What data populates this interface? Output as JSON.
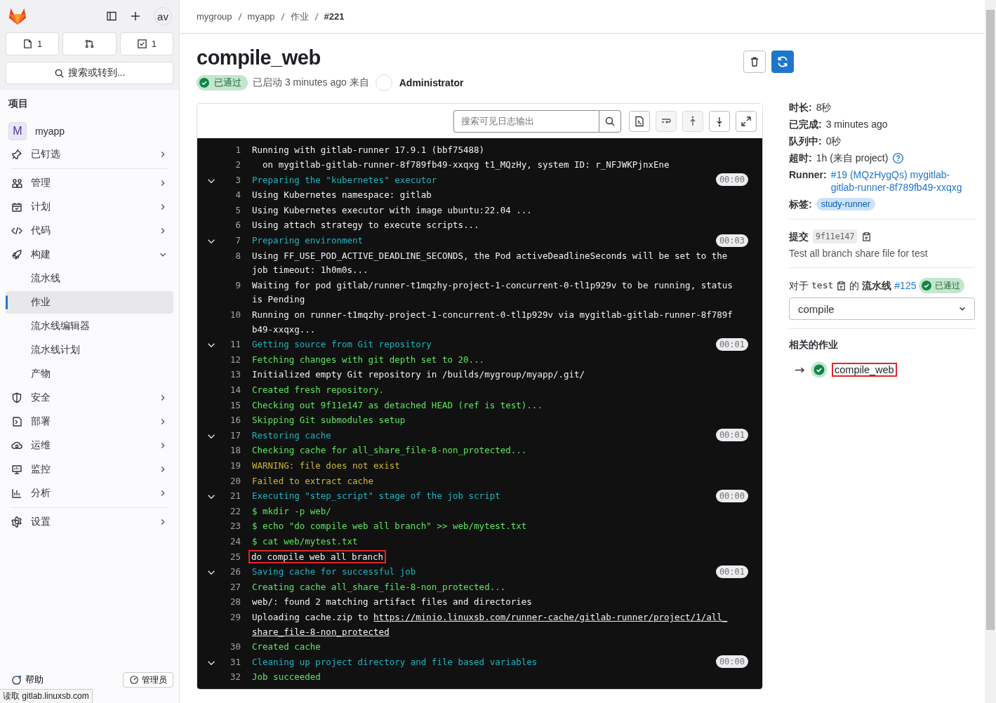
{
  "sidebar": {
    "avatar": "av",
    "top_buttons": [
      {
        "kind": "issues",
        "count": "1"
      },
      {
        "kind": "merge"
      },
      {
        "kind": "todo",
        "count": "1"
      }
    ],
    "search": "搜索或转到...",
    "section_title": "项目",
    "project": {
      "initial": "M",
      "name": "myapp"
    },
    "items": [
      {
        "label": "已钉选",
        "expanded": false
      },
      {
        "label": "管理",
        "expanded": false
      },
      {
        "label": "计划",
        "expanded": false
      },
      {
        "label": "代码",
        "expanded": false
      },
      {
        "label": "构建",
        "expanded": true,
        "children": [
          {
            "label": "流水线",
            "selected": false
          },
          {
            "label": "作业",
            "selected": true
          },
          {
            "label": "流水线编辑器",
            "selected": false
          },
          {
            "label": "流水线计划",
            "selected": false
          },
          {
            "label": "产物",
            "selected": false
          }
        ]
      },
      {
        "label": "安全",
        "expanded": false
      },
      {
        "label": "部署",
        "expanded": false
      },
      {
        "label": "运维",
        "expanded": false
      },
      {
        "label": "监控",
        "expanded": false
      },
      {
        "label": "分析",
        "expanded": false
      },
      {
        "label": "设置",
        "expanded": false
      }
    ],
    "help": "帮助",
    "admin": "管理员"
  },
  "breadcrumbs": [
    "mygroup",
    "myapp",
    "作业",
    "#221"
  ],
  "job": {
    "title": "compile_web",
    "status": "已通过",
    "meta": "已启动 3 minutes ago 来自",
    "user": "Administrator"
  },
  "log": {
    "search_placeholder": "搜索可见日志输出",
    "lines": [
      {
        "n": "1",
        "kind": "plain",
        "text": "Running with gitlab-runner 17.9.1 (bbf75488)"
      },
      {
        "n": "2",
        "kind": "plain",
        "text": "  on mygitlab-gitlab-runner-8f789fb49-xxqxg t1_MQzHy, system ID: r_NFJWKPjnxEne"
      },
      {
        "n": "3",
        "kind": "section",
        "text": "Preparing the \"kubernetes\" executor",
        "duration": "00:00"
      },
      {
        "n": "4",
        "kind": "plain",
        "text": "Using Kubernetes namespace: gitlab"
      },
      {
        "n": "5",
        "kind": "plain",
        "text": "Using Kubernetes executor with image ubuntu:22.04 ..."
      },
      {
        "n": "6",
        "kind": "plain",
        "text": "Using attach strategy to execute scripts..."
      },
      {
        "n": "7",
        "kind": "section",
        "text": "Preparing environment",
        "duration": "00:03"
      },
      {
        "n": "8",
        "kind": "plain",
        "text": "Using FF_USE_POD_ACTIVE_DEADLINE_SECONDS, the Pod activeDeadlineSeconds will be set to the job timeout: 1h0m0s..."
      },
      {
        "n": "9",
        "kind": "plain",
        "text": "Waiting for pod gitlab/runner-t1mqzhy-project-1-concurrent-0-tl1p929v to be running, status is Pending"
      },
      {
        "n": "10",
        "kind": "plain",
        "text": "Running on runner-t1mqzhy-project-1-concurrent-0-tl1p929v via mygitlab-gitlab-runner-8f789fb49-xxqxg..."
      },
      {
        "n": "11",
        "kind": "section",
        "text": "Getting source from Git repository",
        "duration": "00:01"
      },
      {
        "n": "12",
        "kind": "success",
        "text": "Fetching changes with git depth set to 20..."
      },
      {
        "n": "13",
        "kind": "plain",
        "text": "Initialized empty Git repository in /builds/mygroup/myapp/.git/"
      },
      {
        "n": "14",
        "kind": "success",
        "text": "Created fresh repository."
      },
      {
        "n": "15",
        "kind": "success",
        "text": "Checking out 9f11e147 as detached HEAD (ref is test)..."
      },
      {
        "n": "16",
        "kind": "success",
        "text": "Skipping Git submodules setup"
      },
      {
        "n": "17",
        "kind": "section",
        "text": "Restoring cache",
        "duration": "00:01"
      },
      {
        "n": "18",
        "kind": "success",
        "text": "Checking cache for all_share_file-8-non_protected..."
      },
      {
        "n": "19",
        "kind": "warning",
        "text": "WARNING: file does not exist"
      },
      {
        "n": "20",
        "kind": "warning",
        "text": "Failed to extract cache"
      },
      {
        "n": "21",
        "kind": "section",
        "text": "Executing \"step_script\" stage of the job script",
        "duration": "00:00"
      },
      {
        "n": "22",
        "kind": "success",
        "text": "$ mkdir -p web/"
      },
      {
        "n": "23",
        "kind": "success",
        "text": "$ echo \"do compile web all branch\" >> web/mytest.txt"
      },
      {
        "n": "24",
        "kind": "success",
        "text": "$ cat web/mytest.txt"
      },
      {
        "n": "25",
        "kind": "plain",
        "text": "do compile web all branch",
        "highlighted": true
      },
      {
        "n": "26",
        "kind": "section",
        "text": "Saving cache for successful job",
        "duration": "00:01"
      },
      {
        "n": "27",
        "kind": "success",
        "text": "Creating cache all_share_file-8-non_protected..."
      },
      {
        "n": "28",
        "kind": "plain",
        "text": "web/: found 2 matching artifact files and directories"
      },
      {
        "n": "29",
        "kind": "plain",
        "text": "Uploading cache.zip to ",
        "link_lines": [
          "https://minio.linuxsb.com/runner-cache/gitlab-runner/project/1/all_",
          "share_file-8-non_protected"
        ]
      },
      {
        "n": "30",
        "kind": "success",
        "text": "Created cache"
      },
      {
        "n": "31",
        "kind": "section",
        "text": "Cleaning up project directory and file based variables",
        "duration": "00:00"
      },
      {
        "n": "32",
        "kind": "success",
        "text": "Job succeeded"
      }
    ]
  },
  "details": {
    "rows": [
      {
        "label": "时长:",
        "value": "8秒"
      },
      {
        "label": "已完成:",
        "value": "3 minutes ago"
      },
      {
        "label": "队列中:",
        "value": "0秒"
      },
      {
        "label": "超时:",
        "value": "1h (来自 project)",
        "help": true
      }
    ],
    "runner": {
      "label": "Runner:",
      "link": "#19 (MQzHygQs) mygitlab-gitlab-runner-8f789fb49-xxqxg"
    },
    "tags": {
      "label": "标签:",
      "tag": "study-runner"
    },
    "commit": {
      "label": "提交",
      "sha": "9f11e147",
      "message": "Test all branch share file for test"
    },
    "pipeline": {
      "prefix": "对于",
      "branch": "test",
      "of": "的",
      "word": "流水线",
      "link": "#125",
      "status": "已通过"
    },
    "stage": "compile",
    "related_title": "相关的作业",
    "related_jobs": [
      {
        "name": "compile_web",
        "selected": true
      }
    ]
  },
  "status_bar": "读取 gitlab.linuxsb.com"
}
